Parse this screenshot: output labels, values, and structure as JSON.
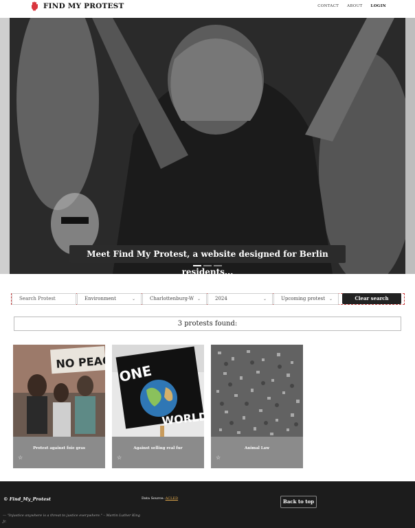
{
  "header": {
    "brand_name": "FIND MY PROTEST",
    "nav": {
      "contact": "CONTACT",
      "about": "ABOUT",
      "login": "LOGIN"
    }
  },
  "hero": {
    "caption": "Meet Find My Protest, a website designed for Berlin residents...",
    "slides_total": 3,
    "active_slide": 1
  },
  "filters": {
    "search_placeholder": "Search Protest",
    "category": "Environment",
    "district": "Charlottenburg-W",
    "year": "2024",
    "timing": "Upcoming protest",
    "clear_label": "Clear search"
  },
  "results": {
    "count_text": "3 protests found:"
  },
  "cards": [
    {
      "title": "Protest against foie gras",
      "image": "protest-no-peace-sign",
      "star_icon": "star-outline-icon"
    },
    {
      "title": "Against selling real fur",
      "image": "one-world-sign",
      "star_icon": "star-outline-icon"
    },
    {
      "title": "Animal Law",
      "image": "crowd-aerial-view",
      "star_icon": "star-outline-icon"
    }
  ],
  "footer": {
    "brand": "Find_My_Protest",
    "quote": "\"Injustice anywhere is a threat to justice everywhere.\" – Martin Luther King Jr.",
    "source_label": "Data Source:",
    "source_link": "ACLED",
    "back_to_top": "Back to top"
  },
  "colors": {
    "accent_red": "#d9363e",
    "footer_bg": "#1c1c1c",
    "link_orange": "#e3a94b"
  }
}
